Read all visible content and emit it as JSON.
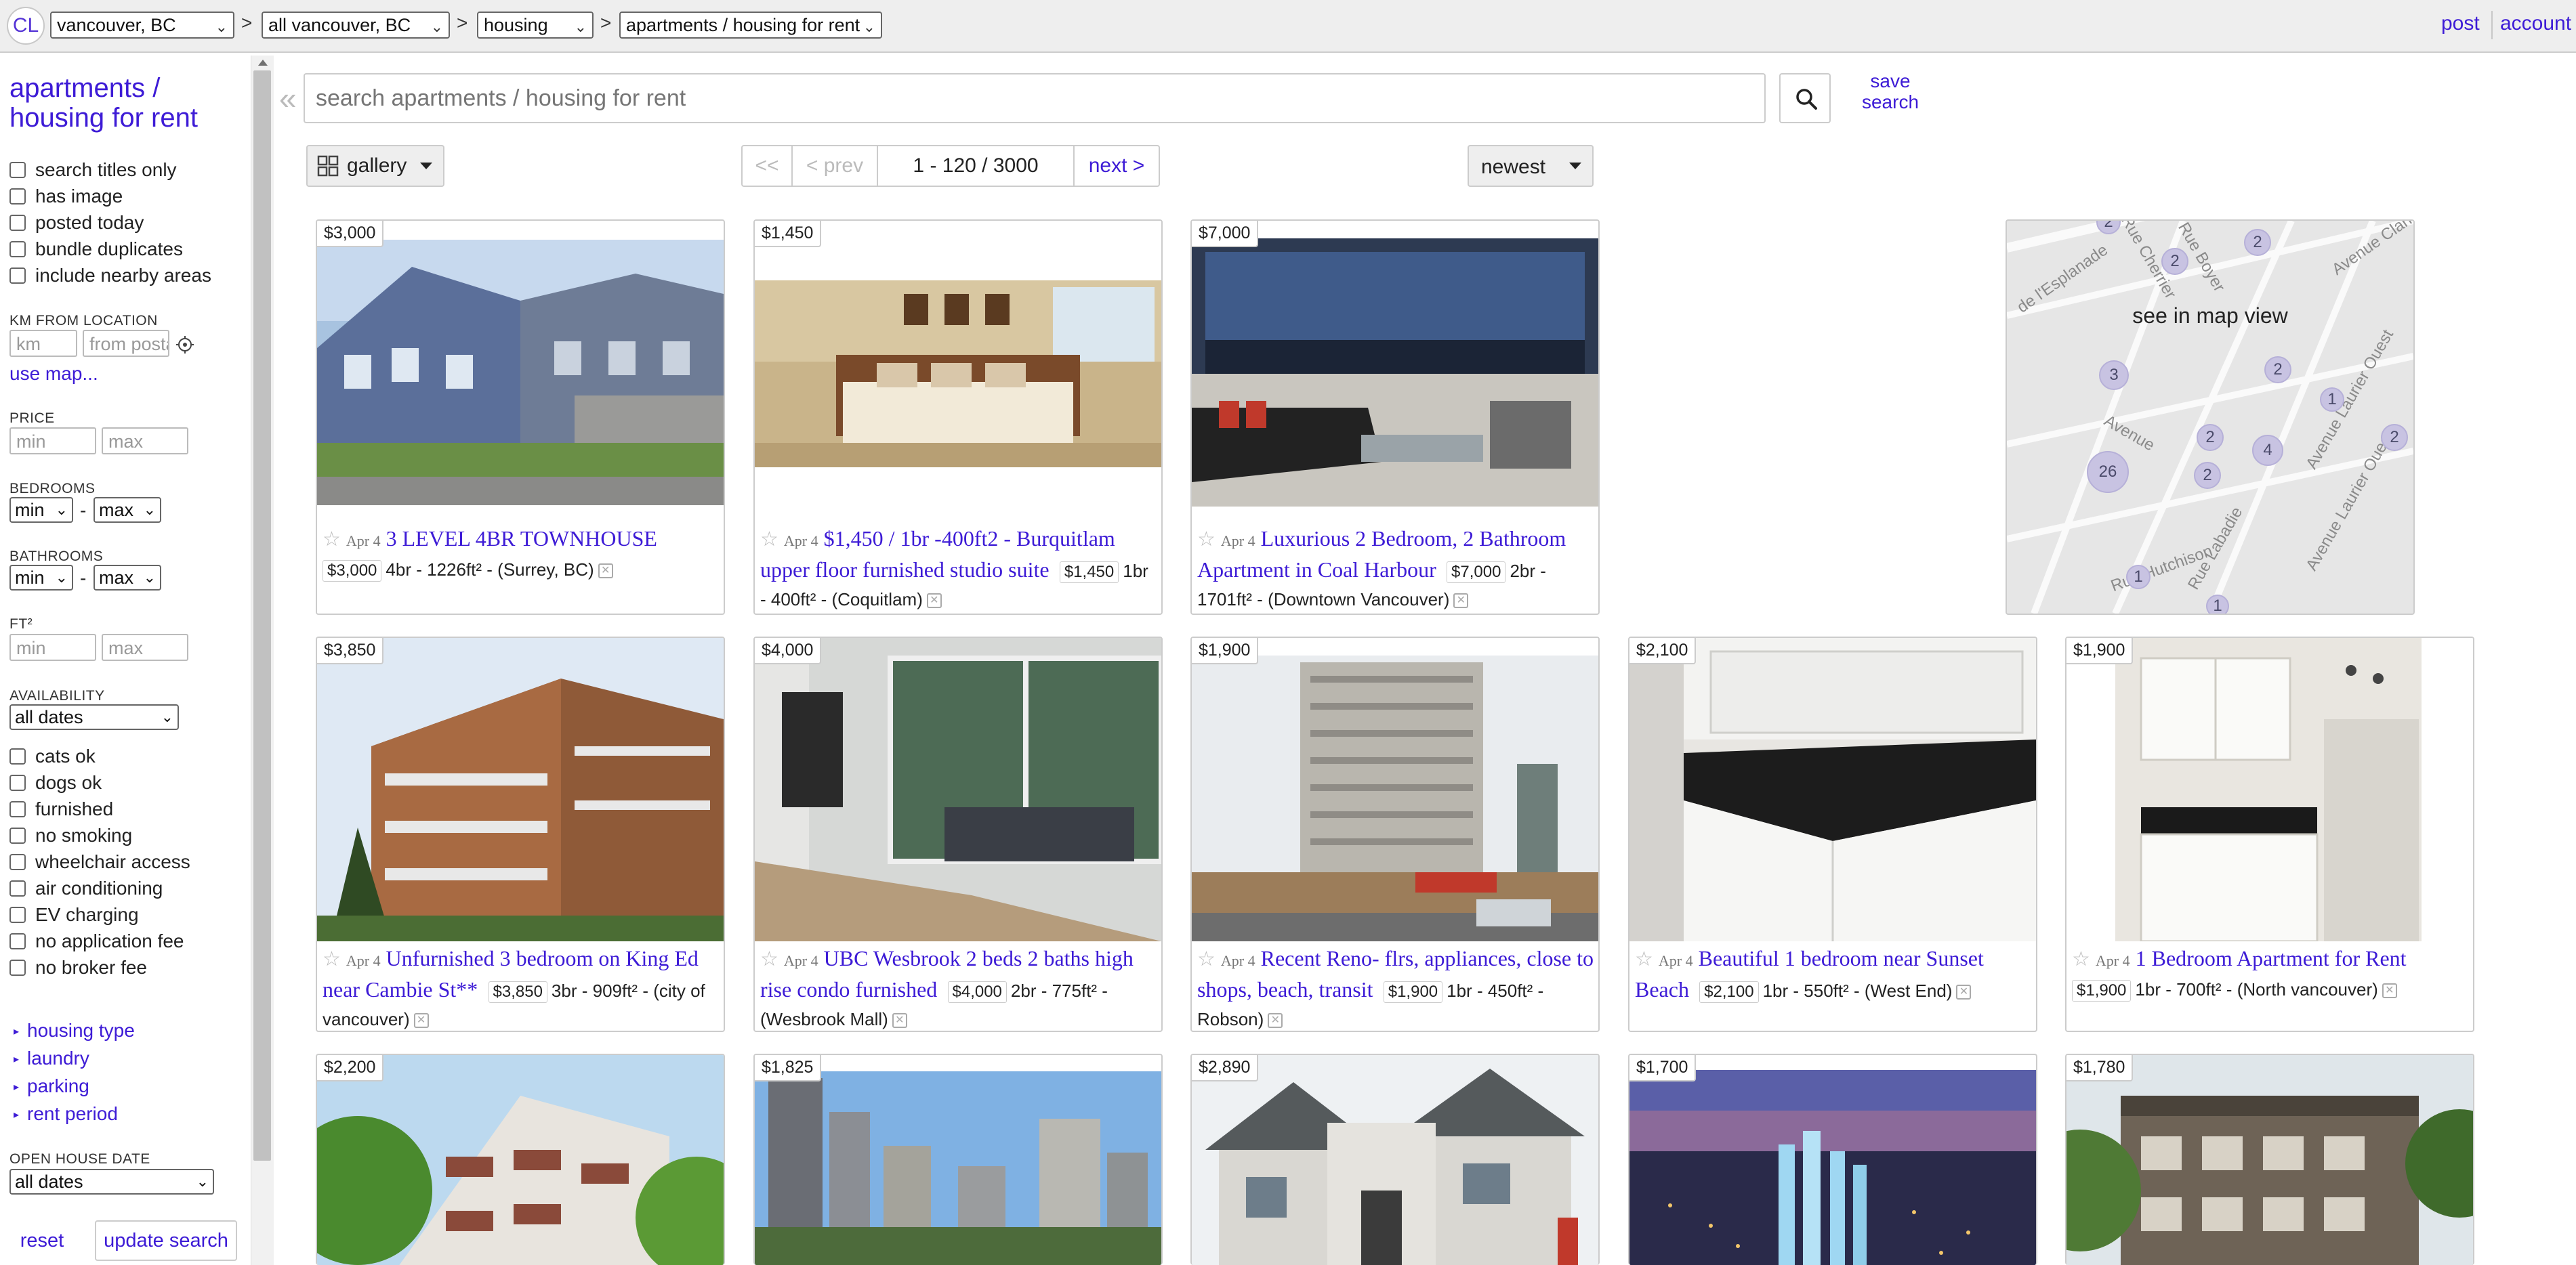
{
  "topbar": {
    "logo": "CL",
    "breadcrumbs": [
      {
        "label": "vancouver, BC"
      },
      {
        "label": "all vancouver, BC"
      },
      {
        "label": "housing"
      },
      {
        "label": "apartments / housing for rent"
      }
    ],
    "separator": ">",
    "post": "post",
    "account": "account"
  },
  "sidebar": {
    "title": "apartments / housing for rent",
    "top_checks": [
      "search titles only",
      "has image",
      "posted today",
      "bundle duplicates",
      "include nearby areas"
    ],
    "km_label": "KM FROM LOCATION",
    "km_placeholder": "km",
    "postal_placeholder": "from postal",
    "use_map": "use map...",
    "price_label": "PRICE",
    "min_placeholder": "min",
    "max_placeholder": "max",
    "bedrooms_label": "BEDROOMS",
    "bathrooms_label": "BATHROOMS",
    "min_select": "min",
    "max_select": "max",
    "dash": "-",
    "ft_label": "FT²",
    "availability_label": "AVAILABILITY",
    "availability_value": "all dates",
    "amenity_checks": [
      "cats ok",
      "dogs ok",
      "furnished",
      "no smoking",
      "wheelchair access",
      "air conditioning",
      "EV charging",
      "no application fee",
      "no broker fee"
    ],
    "expanders": [
      "housing type",
      "laundry",
      "parking",
      "rent period"
    ],
    "open_house_label": "OPEN HOUSE DATE",
    "open_house_value": "all dates",
    "reset": "reset",
    "update": "update search"
  },
  "search": {
    "placeholder": "search apartments / housing for rent",
    "save_line1": "save",
    "save_line2": "search"
  },
  "controls": {
    "view": "gallery",
    "pager_first": "<<",
    "pager_prev": "< prev",
    "range": "1 - 120 / 3000",
    "pager_next": "next >",
    "sort": "newest"
  },
  "map": {
    "label": "see in map view",
    "clusters": [
      "2",
      "2",
      "2",
      "3",
      "2",
      "1",
      "2",
      "4",
      "2",
      "26",
      "2",
      "1",
      "1"
    ],
    "streets": [
      "Rue Cherrier",
      "Rue Boyer",
      "de l'Esplanade",
      "Avenue Clark",
      "Avenue",
      "Avenue Laurier Ouest",
      "Rue Hutchison",
      "Avenue Laurier Ouest",
      "Rue Labadie"
    ]
  },
  "listings": [
    {
      "price": "$3,000",
      "date": "Apr 4",
      "title": "3 LEVEL 4BR TOWNHOUSE",
      "housing": "4br - 1226ft²",
      "hood": "(Surrey, BC)",
      "image": "townhouse-exterior"
    },
    {
      "price": "$1,450",
      "date": "Apr 4",
      "title": "$1,450 / 1br -400ft2 - Burquitlam upper floor furnished studio suite",
      "housing": "1br - 400ft²",
      "hood": "(Coquitlam)",
      "image": "bedroom"
    },
    {
      "price": "$7,000",
      "date": "Apr 4",
      "title": "Luxurious 2 Bedroom, 2 Bathroom Apartment in Coal Harbour",
      "housing": "2br - 1701ft²",
      "hood": "(Downtown Vancouver)",
      "image": "living-room-view"
    },
    {
      "price": "$3,850",
      "date": "Apr 4",
      "title": "Unfurnished 3 bedroom on King Ed near Cambie St**",
      "housing": "3br - 909ft²",
      "hood": "(city of vancouver)",
      "image": "modern-building"
    },
    {
      "price": "$4,000",
      "date": "Apr 4",
      "title": "UBC Wesbrook 2 beds 2 baths high rise condo furnished",
      "housing": "2br - 775ft²",
      "hood": "(Wesbrook Mall)",
      "image": "condo-interior"
    },
    {
      "price": "$1,900",
      "date": "Apr 4",
      "title": "Recent Reno- flrs, appliances, close to shops, beach, transit",
      "housing": "1br - 450ft²",
      "hood": "Robson)",
      "image": "tower-street"
    },
    {
      "price": "$2,100",
      "date": "Apr 4",
      "title": "Beautiful 1 bedroom near Sunset Beach",
      "housing": "1br - 550ft²",
      "hood": "(West End)",
      "image": "kitchen"
    },
    {
      "price": "$1,900",
      "date": "Apr 4",
      "title": "1 Bedroom Apartment for Rent",
      "housing": "1br - 700ft²",
      "hood": "(North vancouver)",
      "image": "kitchen-2"
    },
    {
      "price": "$2,200",
      "image": "apartment-trees"
    },
    {
      "price": "$1,825",
      "image": "city-skyline"
    },
    {
      "price": "$2,890",
      "image": "house"
    },
    {
      "price": "$1,700",
      "image": "night-city"
    },
    {
      "price": "$1,780",
      "image": "apartment-block"
    }
  ],
  "colors": {
    "link": "#3d1bd6",
    "border": "#cccccc",
    "topbar": "#eeeeee"
  }
}
